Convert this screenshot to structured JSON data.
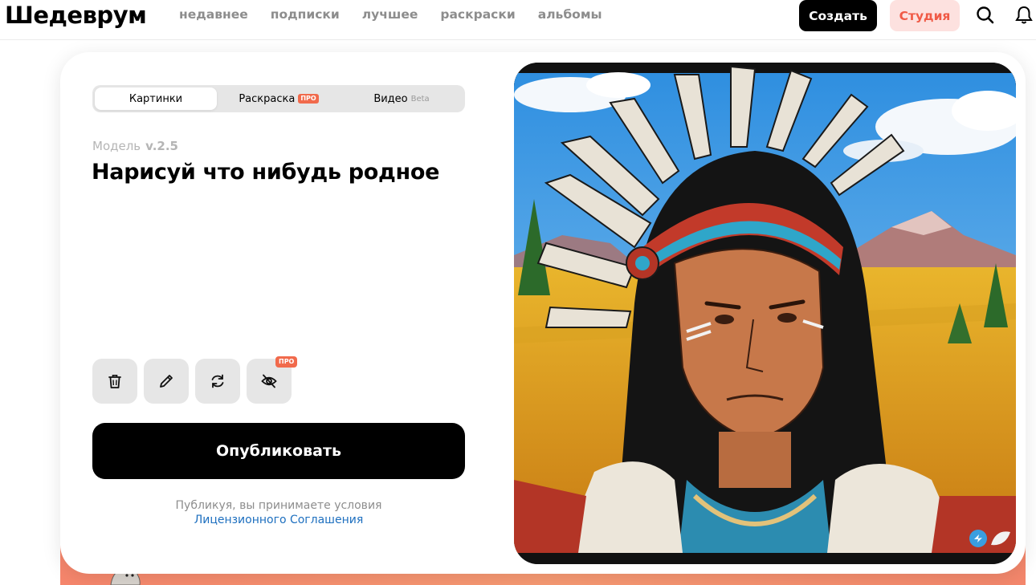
{
  "header": {
    "logo": "Шедеврум",
    "nav": [
      "недавнее",
      "подписки",
      "лучшее",
      "раскраски",
      "альбомы"
    ],
    "create_label": "Создать",
    "studio_label": "Студия",
    "search_icon": "search-icon",
    "bell_icon": "bell-icon"
  },
  "tabs": {
    "pictures": "Картинки",
    "coloring": "Раскраска",
    "coloring_badge": "ПРО",
    "video": "Видео",
    "video_badge": "Beta",
    "active": "pictures"
  },
  "model": {
    "label": "Модель",
    "version": "v.2.5"
  },
  "prompt": "Нарисуй что нибудь родное",
  "tools": [
    {
      "icon": "trash-icon"
    },
    {
      "icon": "pencil-icon"
    },
    {
      "icon": "refresh-icon"
    },
    {
      "icon": "eye-off-icon",
      "badge": "ПРО"
    }
  ],
  "publish_label": "Опубликовать",
  "terms": {
    "text": "Публикуя, вы принимаете условия",
    "link": "Лицензионного Соглашения"
  },
  "colors": {
    "accent": "#f16a4c",
    "studio_bg": "#fde1df",
    "link": "#1d6fbf"
  }
}
